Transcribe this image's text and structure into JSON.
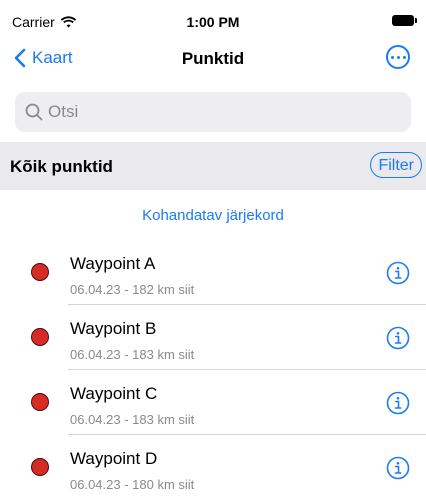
{
  "status_bar": {
    "carrier": "Carrier",
    "time": "1:00 PM"
  },
  "nav": {
    "back_label": "Kaart",
    "title": "Punktid"
  },
  "search": {
    "placeholder": "Otsi",
    "value": ""
  },
  "section": {
    "title": "Kõik punktid",
    "filter_label": "Filter"
  },
  "custom_order_label": "Kohandatav järjekord",
  "waypoints": [
    {
      "name": "Waypoint A",
      "subtitle": "06.04.23 - 182 km siit",
      "color": "#d72b26"
    },
    {
      "name": "Waypoint B",
      "subtitle": "06.04.23 - 183 km siit",
      "color": "#d72b26"
    },
    {
      "name": "Waypoint C",
      "subtitle": "06.04.23 - 183 km siit",
      "color": "#d72b26"
    },
    {
      "name": "Waypoint D",
      "subtitle": "06.04.23 - 180 km siit",
      "color": "#d72b26"
    }
  ],
  "colors": {
    "accent": "#1a7cf0",
    "waypoint": "#d72b26"
  },
  "icons": [
    "wifi-icon",
    "battery-icon",
    "chevron-left-icon",
    "more-icon",
    "search-icon",
    "waypoint-dot-icon",
    "info-icon"
  ]
}
